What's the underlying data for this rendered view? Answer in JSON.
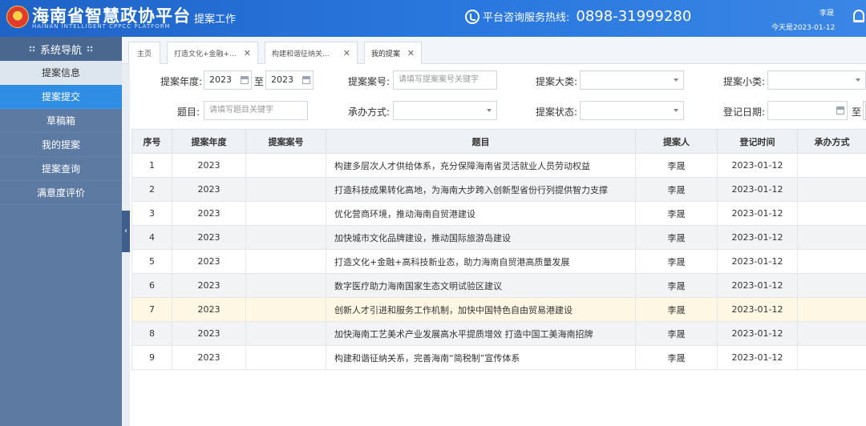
{
  "header": {
    "brand": "海南省智慧政协平台",
    "brand_en": "HAINAN INTELLIGENT CPPCC PLATFORM",
    "module": "提案工作",
    "hotline_label": "平台咨询服务热线:",
    "hotline_number": "0898-31999280",
    "user": "李晟",
    "today": "今天是2023-01-12"
  },
  "sidebar": {
    "title": "系统导航",
    "items": [
      "提案信息",
      "提案提交",
      "草稿箱",
      "我的提案",
      "提案查询",
      "满意度评价"
    ]
  },
  "tabs": [
    {
      "label": "主页",
      "closable": false
    },
    {
      "label": "打造文化+金融+...",
      "closable": true
    },
    {
      "label": "构建和谐征纳关...",
      "closable": true
    },
    {
      "label": "我的提案",
      "closable": true
    }
  ],
  "form": {
    "year_label": "提案年度:",
    "year_from": "2023",
    "year_to_sep": "至",
    "year_to": "2023",
    "case_label": "提案案号:",
    "case_placeholder": "请填写提案案号关键字",
    "cat_label": "提案大类:",
    "subcat_label": "提案小类:",
    "title_label": "题目:",
    "title_placeholder": "请填写题目关键字",
    "handle_label": "承办方式:",
    "status_label": "提案状态:",
    "date_label": "登记日期:",
    "date_to_sep": "至"
  },
  "table": {
    "headers": [
      "序号",
      "提案年度",
      "提案案号",
      "题目",
      "提案人",
      "登记时间",
      "承办方式"
    ],
    "rows": [
      [
        "1",
        "2023",
        "",
        "构建多层次人才供给体系，充分保障海南省灵活就业人员劳动权益",
        "李晟",
        "2023-01-12",
        ""
      ],
      [
        "2",
        "2023",
        "",
        "打造科技成果转化高地，为海南大步跨入创新型省份行列提供智力支撑",
        "李晟",
        "2023-01-12",
        ""
      ],
      [
        "3",
        "2023",
        "",
        "优化营商环境，推动海南自贸港建设",
        "李晟",
        "2023-01-12",
        ""
      ],
      [
        "4",
        "2023",
        "",
        "加快城市文化品牌建设，推动国际旅游岛建设",
        "李晟",
        "2023-01-12",
        ""
      ],
      [
        "5",
        "2023",
        "",
        "打造文化+金融+高科技新业态，助力海南自贸港高质量发展",
        "李晟",
        "2023-01-12",
        ""
      ],
      [
        "6",
        "2023",
        "",
        "数字医疗助力海南国家生态文明试验区建议",
        "李晟",
        "2023-01-12",
        ""
      ],
      [
        "7",
        "2023",
        "",
        "创新人才引进和服务工作机制，加快中国特色自由贸易港建设",
        "李晟",
        "2023-01-12",
        ""
      ],
      [
        "8",
        "2023",
        "",
        "加快海南工艺美术产业发展高水平提质增效 打造中国工美海南招牌",
        "李晟",
        "2023-01-12",
        ""
      ],
      [
        "9",
        "2023",
        "",
        "构建和谐征纳关系，完善海南“简税制”宣传体系",
        "李晟",
        "2023-01-12",
        ""
      ]
    ]
  },
  "colors": {
    "header": "#2a78df",
    "sidebar": "#5d7aa3",
    "active": "#2f8de4",
    "highlight_row": "#fdf7e3"
  }
}
